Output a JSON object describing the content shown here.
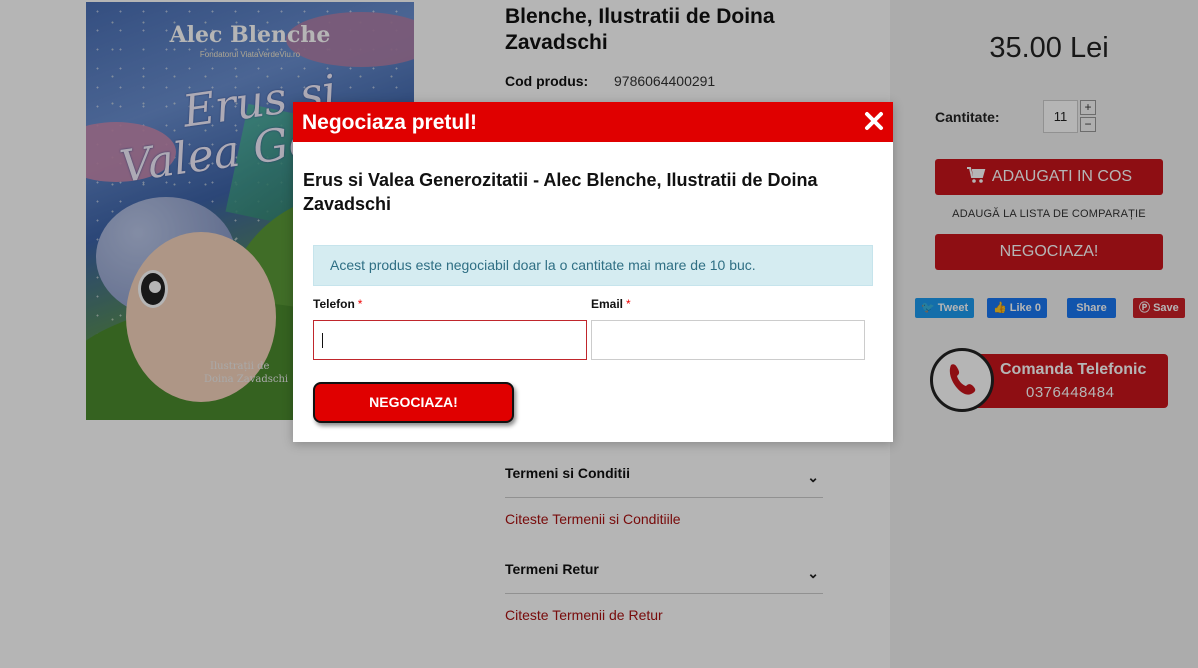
{
  "cover": {
    "author": "Alec Blenche",
    "subtitle": "Fondatorul ViataVerdeViu.ro",
    "title_line1": "Erus și",
    "title_line2": "Valea Gene",
    "illustrator_label": "Ilustrații de",
    "illustrator": "Doina Zavadschi"
  },
  "product": {
    "title": "Blenche, Ilustratii de Doina Zavadschi",
    "code_label": "Cod produs:",
    "code_value": "9786064400291"
  },
  "accordion": [
    {
      "title": "Termeni si Conditii",
      "link": "Citeste Termenii si Conditiile"
    },
    {
      "title": "Termeni Retur",
      "link": "Citeste Termenii de Retur"
    }
  ],
  "sidebar": {
    "price": "35.00 Lei",
    "quantity_label": "Cantitate:",
    "quantity_value": "11",
    "qty_plus": "+",
    "qty_minus": "−",
    "add_to_cart": "ADAUGATI IN COS",
    "compare": "ADAUGĂ LA LISTA DE COMPARAȚIE",
    "negotiate": "NEGOCIAZA!",
    "share": {
      "tweet": "Tweet",
      "like": "Like 0",
      "share": "Share",
      "save": "Save"
    },
    "phone_order": {
      "title": "Comanda Telefonic",
      "number": "0376448484"
    }
  },
  "modal": {
    "title": "Negociaza pretul!",
    "product_name": "Erus si Valea Generozitatii - Alec Blenche, Ilustratii de Doina Zavadschi",
    "notice": "Acest produs este negociabil doar la o cantitate mai mare de 10 buc.",
    "phone_label": "Telefon",
    "email_label": "Email",
    "required_mark": "*",
    "phone_value": "",
    "email_value": "",
    "submit": "NEGOCIAZA!"
  },
  "colors": {
    "brand_red": "#e00000",
    "button_red": "#c9141c",
    "notice_bg": "#d5ecf1",
    "link_red": "#a11"
  }
}
